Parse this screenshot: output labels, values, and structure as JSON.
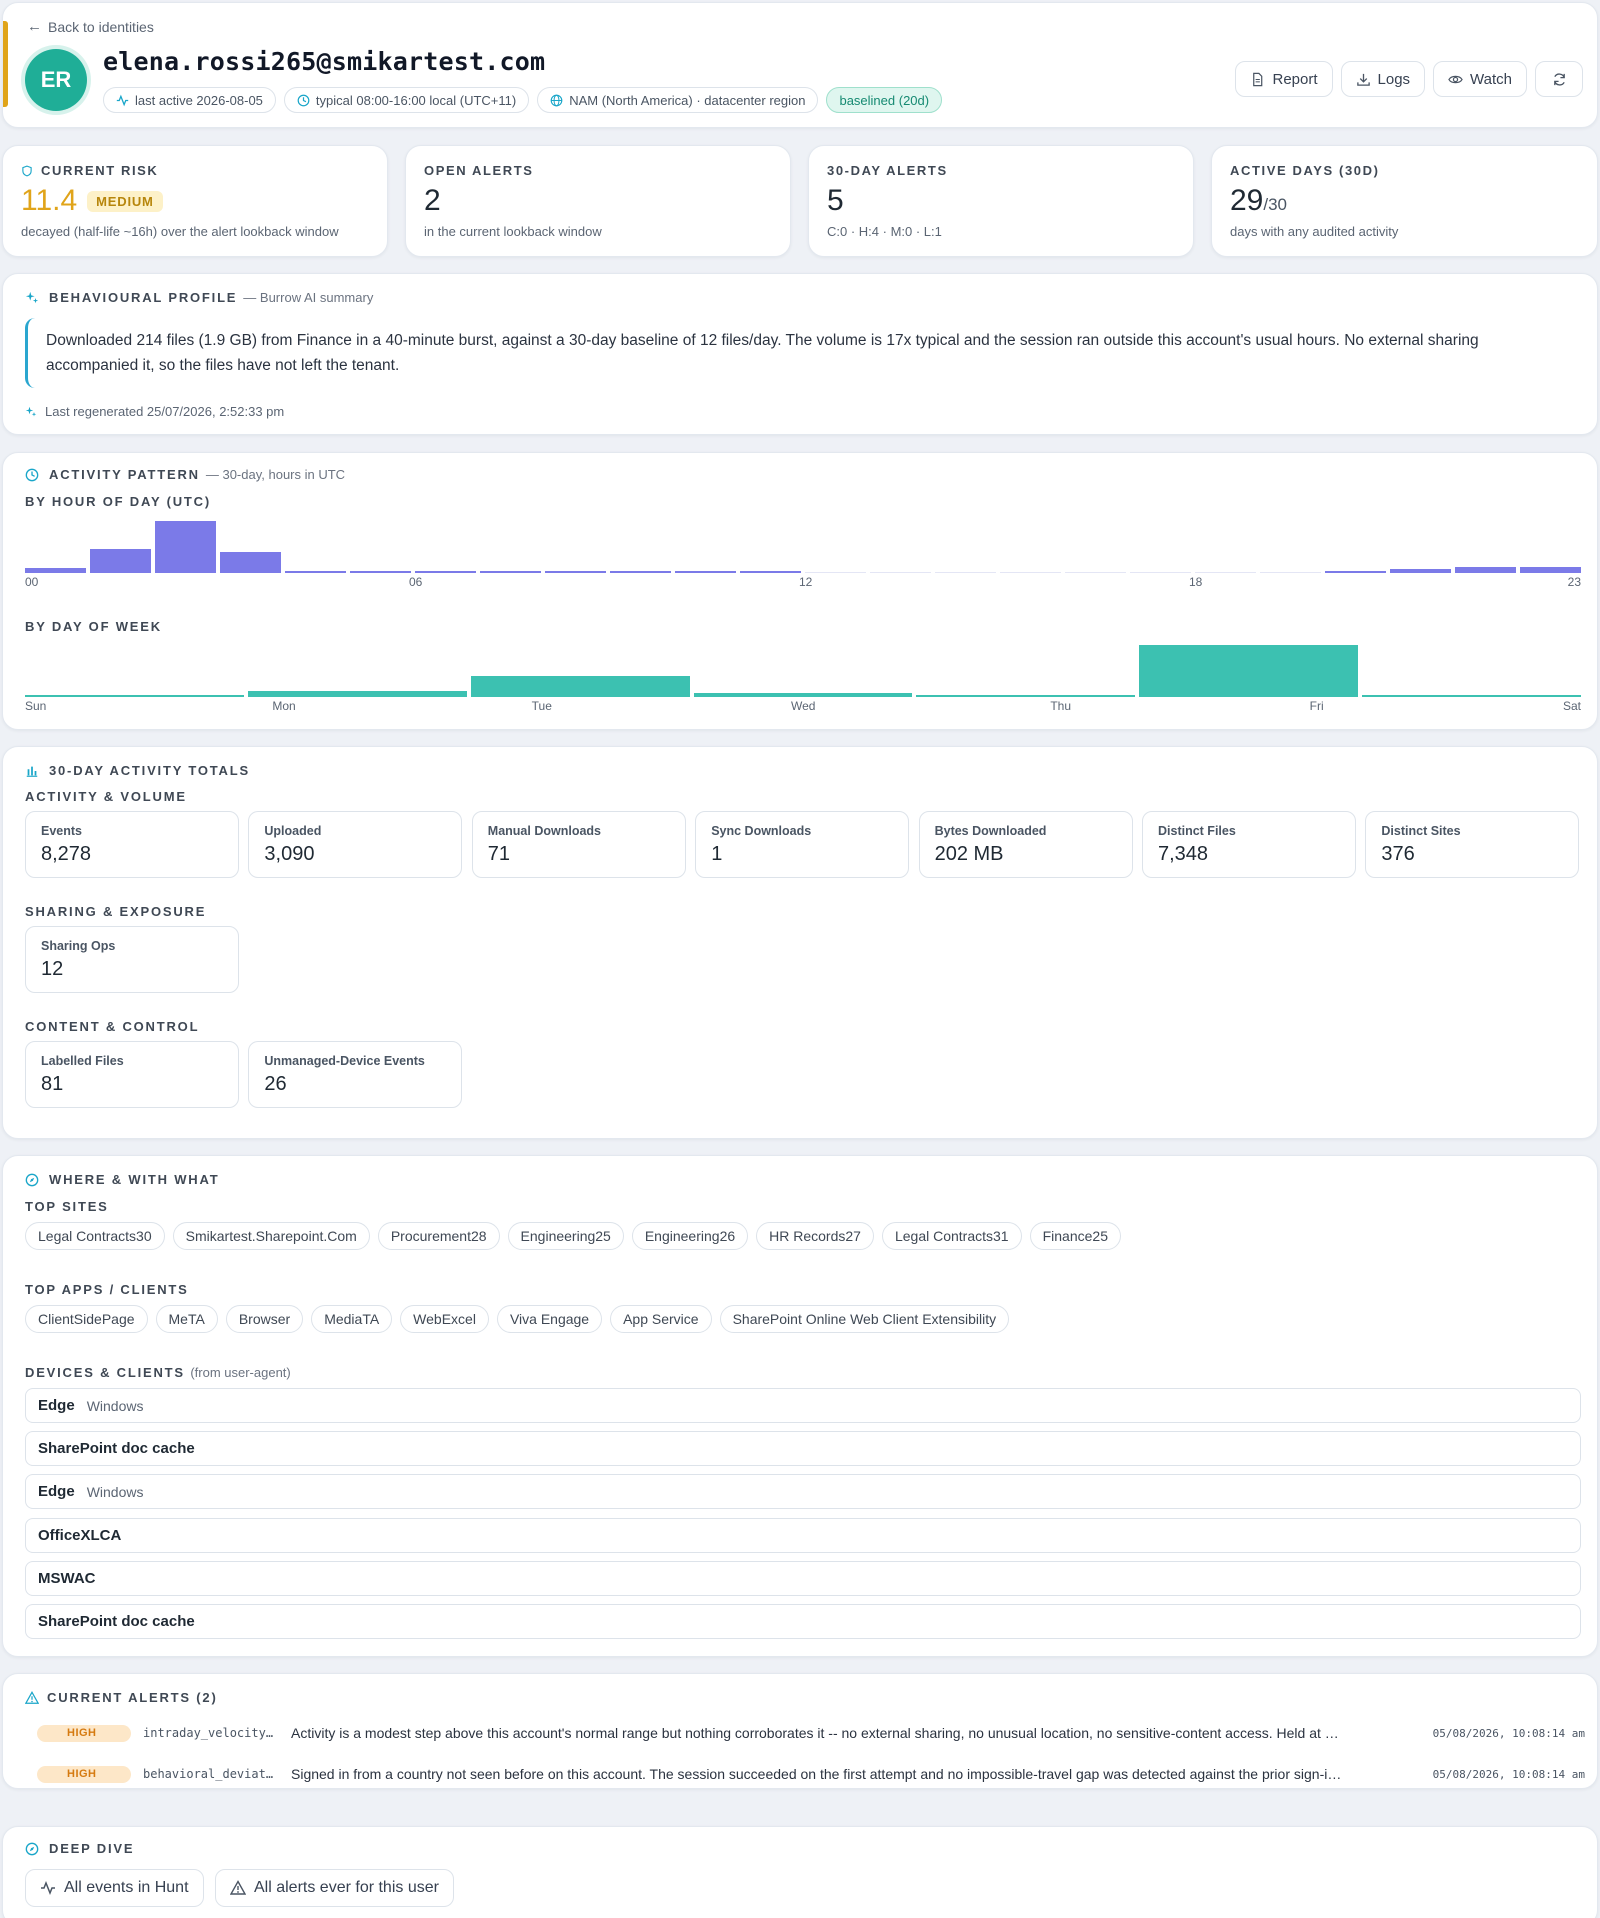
{
  "colors": {
    "accent": "#e0a41a",
    "brand": "#1fae97",
    "hour_bars": "#7b7ae8",
    "weekday_bars": "#3cc1b1",
    "high": "#d57a10"
  },
  "header": {
    "back_label": "Back to identities",
    "avatar_initials": "ER",
    "email": "elena.rossi265@smikartest.com",
    "chips": {
      "last_active": "last active 2026-08-05",
      "typical_hours": "typical 08:00-16:00 local (UTC+11)",
      "region": "NAM (North America) · datacenter region",
      "baseline": "baselined (20d)"
    },
    "actions": {
      "report": "Report",
      "logs": "Logs",
      "watch": "Watch"
    }
  },
  "stats": {
    "risk": {
      "label": "CURRENT RISK",
      "value": "11.4",
      "badge": "MEDIUM",
      "sub": "decayed (half-life ~16h) over the alert lookback window"
    },
    "open_alerts": {
      "label": "OPEN ALERTS",
      "value": "2",
      "sub": "in the current lookback window"
    },
    "alerts_30d": {
      "label": "30-DAY ALERTS",
      "value": "5",
      "sub": "C:0 · H:4 · M:0 · L:1"
    },
    "active_days": {
      "label": "ACTIVE DAYS (30D)",
      "value": "29",
      "suffix": "/30",
      "sub": "days with any audited activity"
    }
  },
  "profile": {
    "title": "BEHAVIOURAL PROFILE",
    "source": "— Burrow AI summary",
    "summary": "Downloaded 214 files (1.9 GB) from Finance in a 40-minute burst, against a 30-day baseline of 12 files/day. The volume is 17x typical and the session ran outside this account's usual hours. No external sharing accompanied it, so the files have not left the tenant.",
    "regenerated": "Last regenerated 25/07/2026, 2:52:33 pm"
  },
  "activity": {
    "title": "ACTIVITY PATTERN",
    "note": "— 30-day, hours in UTC",
    "hour_title": "BY HOUR OF DAY (UTC)",
    "weekday_title": "BY DAY OF WEEK"
  },
  "chart_data": [
    {
      "type": "bar",
      "title": "BY HOUR OF DAY (UTC)",
      "categories": [
        "00",
        "01",
        "02",
        "03",
        "04",
        "05",
        "06",
        "07",
        "08",
        "09",
        "10",
        "11",
        "12",
        "13",
        "14",
        "15",
        "16",
        "17",
        "18",
        "19",
        "20",
        "21",
        "22",
        "23"
      ],
      "tick_labels": [
        "00",
        "06",
        "12",
        "18",
        "23"
      ],
      "values": [
        4,
        19,
        42,
        17,
        2,
        2,
        2,
        2,
        2,
        2,
        2,
        2,
        0,
        0,
        0,
        0,
        0,
        0,
        0,
        0,
        2,
        3,
        5,
        5
      ],
      "color": "#7b7ae8"
    },
    {
      "type": "bar",
      "title": "BY DAY OF WEEK",
      "categories": [
        "Sun",
        "Mon",
        "Tue",
        "Wed",
        "Thu",
        "Fri",
        "Sat"
      ],
      "values": [
        2,
        5,
        17,
        3,
        2,
        42,
        1
      ],
      "color": "#3cc1b1"
    }
  ],
  "totals": {
    "title": "30-DAY ACTIVITY TOTALS",
    "groups": {
      "activity": {
        "title": "ACTIVITY & VOLUME",
        "tiles": [
          {
            "label": "Events",
            "value": "8,278"
          },
          {
            "label": "Uploaded",
            "value": "3,090"
          },
          {
            "label": "Manual Downloads",
            "value": "71"
          },
          {
            "label": "Sync Downloads",
            "value": "1"
          },
          {
            "label": "Bytes Downloaded",
            "value": "202 MB"
          },
          {
            "label": "Distinct Files",
            "value": "7,348"
          },
          {
            "label": "Distinct Sites",
            "value": "376"
          }
        ]
      },
      "sharing": {
        "title": "SHARING & EXPOSURE",
        "tiles": [
          {
            "label": "Sharing Ops",
            "value": "12"
          }
        ]
      },
      "content": {
        "title": "CONTENT & CONTROL",
        "tiles": [
          {
            "label": "Labelled Files",
            "value": "81"
          },
          {
            "label": "Unmanaged-Device Events",
            "value": "26"
          }
        ]
      }
    }
  },
  "where": {
    "title": "WHERE & WITH WHAT",
    "sites_title": "TOP SITES",
    "sites": [
      "Legal Contracts30",
      "Smikartest.Sharepoint.Com",
      "Procurement28",
      "Engineering25",
      "Engineering26",
      "HR Records27",
      "Legal Contracts31",
      "Finance25"
    ],
    "apps_title": "TOP APPS / CLIENTS",
    "apps": [
      "ClientSidePage",
      "MeTA",
      "Browser",
      "MediaTA",
      "WebExcel",
      "Viva Engage",
      "App Service",
      "SharePoint Online Web Client Extensibility"
    ],
    "devices_title": "DEVICES & CLIENTS",
    "devices_note": "(from user-agent)",
    "devices": [
      {
        "name": "Edge",
        "os": "Windows"
      },
      {
        "name": "SharePoint doc cache",
        "os": ""
      },
      {
        "name": "Edge",
        "os": "Windows"
      },
      {
        "name": "OfficeXLCA",
        "os": ""
      },
      {
        "name": "MSWAC",
        "os": ""
      },
      {
        "name": "SharePoint doc cache",
        "os": ""
      }
    ]
  },
  "alerts": {
    "title": "CURRENT ALERTS (2)",
    "items": [
      {
        "severity": "HIGH",
        "rule": "intraday_velocity…",
        "text": "Activity is a modest step above this account's normal range but nothing corroborates it -- no external sharing, no unusual location, no sensitive-content access. Held at …",
        "time": "05/08/2026, 10:08:14 am"
      },
      {
        "severity": "HIGH",
        "rule": "behavioral_deviat…",
        "text": "Signed in from a country not seen before on this account. The session succeeded on the first attempt and no impossible-travel gap was detected against the prior sign-i…",
        "time": "05/08/2026, 10:08:14 am"
      }
    ]
  },
  "deep_dive": {
    "title": "DEEP DIVE",
    "events_btn": "All events in Hunt",
    "alerts_btn": "All alerts ever for this user"
  }
}
